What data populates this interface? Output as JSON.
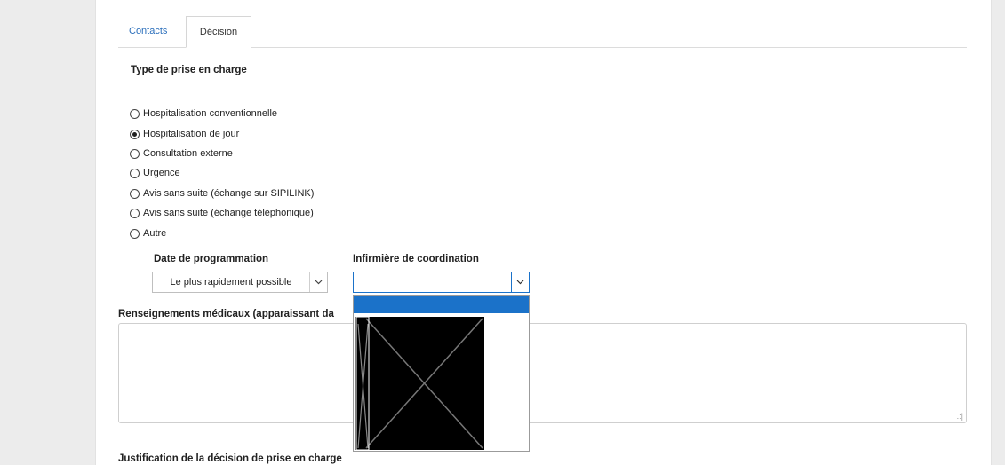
{
  "tabs": [
    {
      "label": "Contacts"
    },
    {
      "label": "Décision"
    }
  ],
  "type_prise_en_charge": {
    "title": "Type de prise en charge",
    "options": [
      {
        "label": "Hospitalisation conventionnelle",
        "selected": false
      },
      {
        "label": "Hospitalisation de jour",
        "selected": true
      },
      {
        "label": "Consultation externe",
        "selected": false
      },
      {
        "label": "Urgence",
        "selected": false
      },
      {
        "label": "Avis sans suite (échange sur SIPILINK)",
        "selected": false
      },
      {
        "label": "Avis sans suite (échange téléphonique)",
        "selected": false
      },
      {
        "label": "Autre",
        "selected": false
      }
    ]
  },
  "date_programmation": {
    "label": "Date de programmation",
    "value": "Le plus rapidement possible"
  },
  "infirmiere": {
    "label": "Infirmière de coordination",
    "value": ""
  },
  "renseignements": {
    "label": "Renseignements médicaux (apparaissant da",
    "value": ""
  },
  "justification": {
    "label": "Justification de la décision de prise en charge"
  },
  "icons": {
    "chevron": "chevron-down-icon",
    "resize": "resize-grip-icon"
  }
}
